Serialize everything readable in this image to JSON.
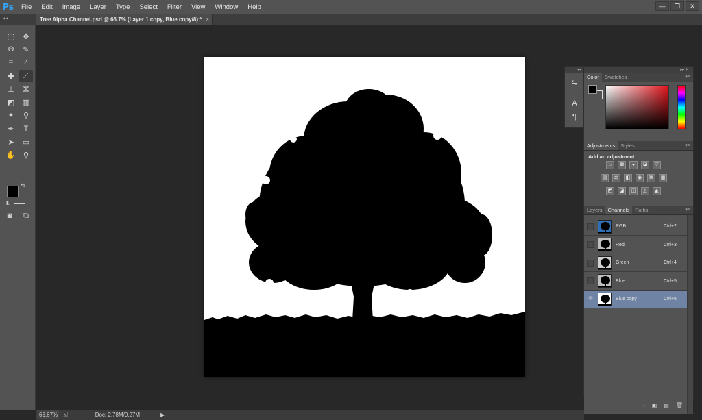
{
  "app": {
    "logo": "Ps"
  },
  "menu": [
    "File",
    "Edit",
    "Image",
    "Layer",
    "Type",
    "Select",
    "Filter",
    "View",
    "Window",
    "Help"
  ],
  "window_controls": {
    "minimize": "—",
    "restore": "❐",
    "close": "✕"
  },
  "document_tab": {
    "title": "Tree Alpha Channel.psd @ 66.7% (Layer 1 copy, Blue copy/8) *",
    "close": "×"
  },
  "tools": [
    {
      "name": "marquee-tool-icon",
      "glyph": "⬚"
    },
    {
      "name": "move-tool-icon",
      "glyph": "✥"
    },
    {
      "name": "lasso-tool-icon",
      "glyph": "ʘ"
    },
    {
      "name": "quick-select-tool-icon",
      "glyph": "✎"
    },
    {
      "name": "crop-tool-icon",
      "glyph": "⌗"
    },
    {
      "name": "eyedropper-tool-icon",
      "glyph": "⁄"
    },
    {
      "name": "spot-heal-tool-icon",
      "glyph": "✚"
    },
    {
      "name": "brush-tool-icon",
      "glyph": "⟋"
    },
    {
      "name": "stamp-tool-icon",
      "glyph": "⊥"
    },
    {
      "name": "history-brush-tool-icon",
      "glyph": "ⵣ"
    },
    {
      "name": "eraser-tool-icon",
      "glyph": "◩"
    },
    {
      "name": "gradient-tool-icon",
      "glyph": "▥"
    },
    {
      "name": "blur-tool-icon",
      "glyph": "●"
    },
    {
      "name": "dodge-tool-icon",
      "glyph": "⚲"
    },
    {
      "name": "pen-tool-icon",
      "glyph": "✒"
    },
    {
      "name": "type-tool-icon",
      "glyph": "T"
    },
    {
      "name": "path-select-tool-icon",
      "glyph": "➤"
    },
    {
      "name": "shape-tool-icon",
      "glyph": "▭"
    },
    {
      "name": "hand-tool-icon",
      "glyph": "✋"
    },
    {
      "name": "zoom-tool-icon",
      "glyph": "⚲"
    }
  ],
  "status": {
    "zoom": "66.67%",
    "doc": "Doc: 2.78M/9.27M",
    "arrow": "▶"
  },
  "color_panel": {
    "tabs": [
      "Color",
      "Swatches"
    ]
  },
  "adjustments_panel": {
    "tabs": [
      "Adjustments",
      "Styles"
    ],
    "heading": "Add an adjustment",
    "row1": [
      "☼",
      "▦",
      "◒",
      "◪",
      "▽"
    ],
    "row2": [
      "▤",
      "⚖",
      "◧",
      "◉",
      "⌘",
      "▦"
    ],
    "row3": [
      "◩",
      "◪",
      "◫",
      "◬",
      "◭"
    ]
  },
  "channels_panel": {
    "tabs": [
      "Layers",
      "Channels",
      "Paths"
    ],
    "channels": [
      {
        "name": "RGB",
        "shortcut": "Ctrl+2"
      },
      {
        "name": "Red",
        "shortcut": "Ctrl+3"
      },
      {
        "name": "Green",
        "shortcut": "Ctrl+4"
      },
      {
        "name": "Blue",
        "shortcut": "Ctrl+5"
      },
      {
        "name": "Blue copy",
        "shortcut": "Ctrl+6"
      }
    ],
    "eye_glyph": "👁",
    "footer": [
      "◌",
      "▣",
      "▤",
      "🗑"
    ]
  },
  "colors": {
    "chrome": "#535353",
    "workspace": "#282828",
    "selection": "#6f84a4",
    "ps_blue": "#31a8ff"
  }
}
